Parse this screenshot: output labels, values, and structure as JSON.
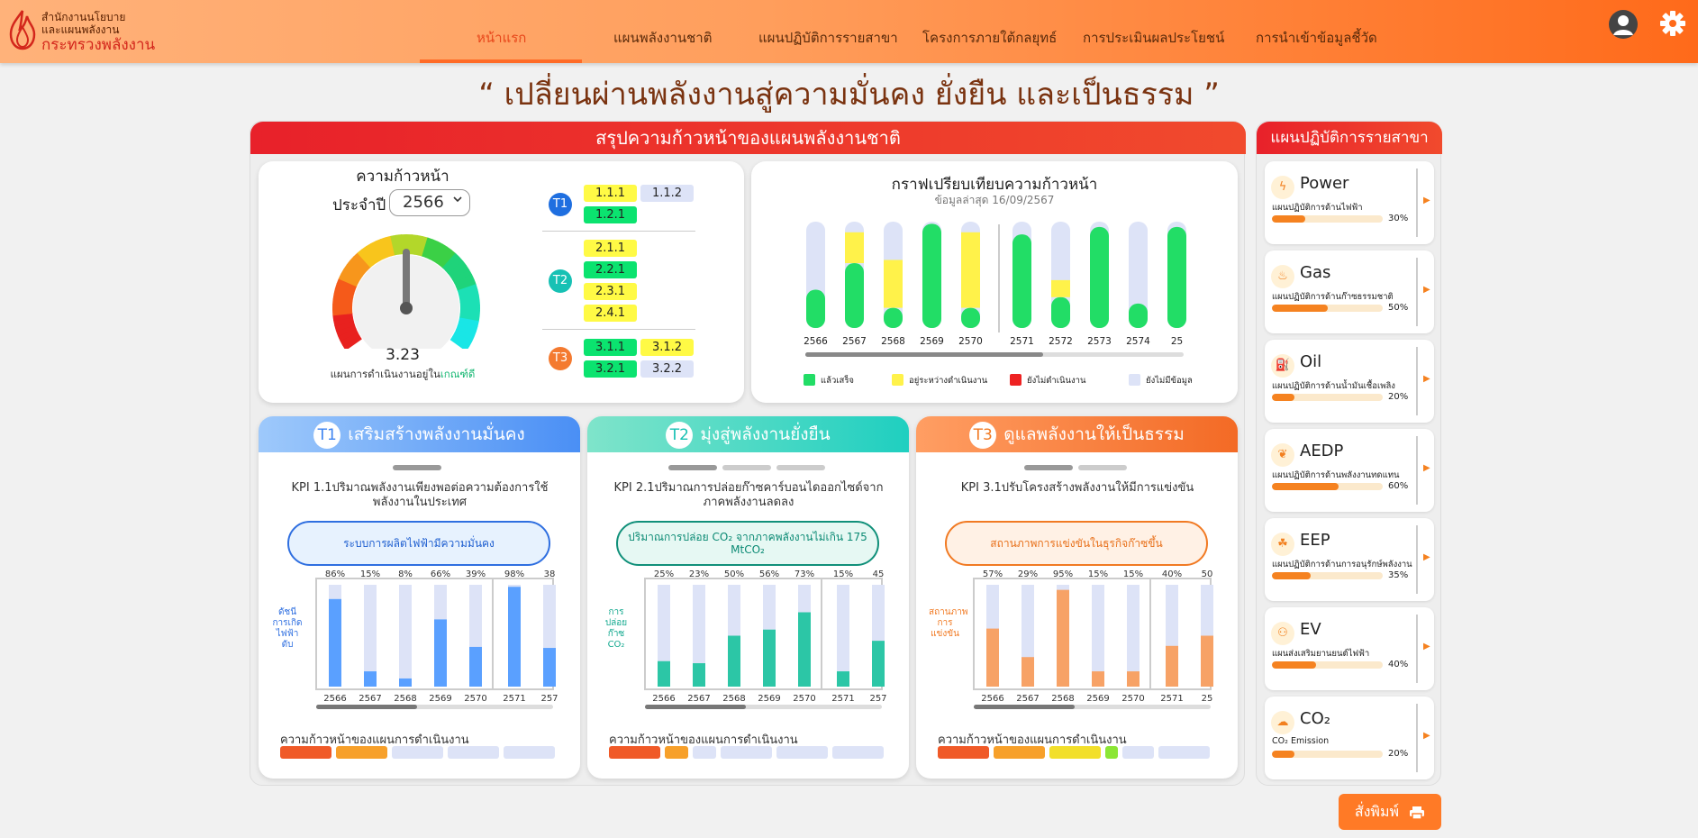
{
  "logo": {
    "line1": "สำนักงานนโยบาย",
    "line2": "และแผนพลังงาน",
    "line3": "กระทรวงพลังงาน"
  },
  "nav": {
    "items": [
      "หน้าแรก",
      "แผนพลังงานชาติ",
      "แผนปฏิบัติการรายสาขา",
      "โครงการภายใต้กลยุทธ์",
      "การประเมินผลประโยชน์",
      "การนำเข้าข้อมูลชี้วัด"
    ],
    "active": 0
  },
  "quote": "“ เปลี่ยนผ่านพลังงานสู่ความมั่นคง ยั่งยืน และเป็นธรรม ”",
  "main_panel": {
    "title": "สรุปความก้าวหน้าของแผนพลังงานชาติ"
  },
  "progress_card": {
    "title": "ความก้าวหน้า",
    "year_label": "ประจำปี",
    "year_value": "2566",
    "gauge_value": "3.23",
    "gauge_fraction": 0.5,
    "status_prefix": "แผนการดำเนินงานอยู่ใน",
    "status_word": "เกณฑ์ดี",
    "groups": [
      {
        "badge": "T1",
        "color": "#1f6fe0",
        "chips": [
          {
            "label": "1.1.1",
            "status": "y"
          },
          {
            "label": "1.1.2",
            "status": "gr"
          },
          {
            "label": "1.2.1",
            "status": "g"
          }
        ]
      },
      {
        "badge": "T2",
        "color": "#17c1b4",
        "chips": [
          {
            "label": "2.1.1",
            "status": "y"
          },
          {
            "label": "2.2.1",
            "status": "g"
          },
          {
            "label": "2.3.1",
            "status": "y"
          },
          {
            "label": "2.4.1",
            "status": "y"
          }
        ]
      },
      {
        "badge": "T3",
        "color": "#f47a30",
        "chips": [
          {
            "label": "3.1.1",
            "status": "g"
          },
          {
            "label": "3.1.2",
            "status": "y"
          },
          {
            "label": "3.2.1",
            "status": "g"
          },
          {
            "label": "3.2.2",
            "status": "gr"
          }
        ]
      }
    ]
  },
  "compare_card": {
    "title": "กราฟเปรียบเทียบความก้าวหน้า",
    "subtitle": "ข้อมูลล่าสุด 16/09/2567",
    "legend": [
      {
        "label": "แล้วเสร็จ",
        "color": "#22dd66"
      },
      {
        "label": "อยู่ระหว่างดำเนินงาน",
        "color": "#fff24a"
      },
      {
        "label": "ยังไม่ดำเนินงาน",
        "color": "#ee2222"
      },
      {
        "label": "ยังไม่มีข้อมูล",
        "color": "#dde3f7"
      }
    ]
  },
  "themes": [
    {
      "badge": "T1",
      "title": "เสริมสร้างพลังงานมั่นคง",
      "kpi": "KPI 1.1ปริมาณพลังงานเพียงพอต่อความต้องการใช้พลังงานในประเทศ",
      "pill": "ระบบการผลิตไฟฟ้ามีความมั่นคง",
      "ylabel": "ดัชนีการเกิดไฟฟ้าดับ",
      "progress_label": "ความก้าวหน้าของแผนการดำเนินงาน",
      "color": "#5aa0ff",
      "light": "#e7f2fe",
      "accent": "#2f6fe0"
    },
    {
      "badge": "T2",
      "title": "มุ่งสู่พลังงานยั่งยืน",
      "kpi": "KPI 2.1ปริมาณการปล่อยก๊าซคาร์บอนไดออกไซด์จากภาคพลังงานลดลง",
      "pill": "ปริมาณการปล่อย CO₂ จากภาคพลังงานไม่เกิน 175 MtCO₂",
      "ylabel": "การปล่อยก๊าซ CO₂",
      "progress_label": "ความก้าวหน้าของแผนการดำเนินงาน",
      "color": "#2cc6a6",
      "light": "#e6f8f3",
      "accent": "#11907a"
    },
    {
      "badge": "T3",
      "title": "ดูแลพลังงานให้เป็นธรรม",
      "kpi": "KPI 3.1ปรับโครงสร้างพลังงานให้มีการแข่งขัน",
      "pill": "สถานภาพการแข่งขันในธุรกิจก๊าซขึ้น",
      "ylabel": "สถานภาพการแข่งขัน",
      "progress_label": "ความก้าวหน้าของแผนการดำเนินงาน",
      "color": "#f7a266",
      "light": "#fff1e5",
      "accent": "#f17a23"
    }
  ],
  "sector_panel": {
    "title": "แผนปฏิบัติการรายสาขา",
    "items": [
      {
        "name": "Power",
        "desc": "แผนปฏิบัติการด้านไฟฟ้า",
        "pct": "30%",
        "value": 0.3,
        "icon": "ϟ"
      },
      {
        "name": "Gas",
        "desc": "แผนปฏิบัติการด้านก๊าซธรรมชาติ",
        "pct": "50%",
        "value": 0.5,
        "icon": "♨"
      },
      {
        "name": "Oil",
        "desc": "แผนปฏิบัติการด้านน้ำมันเชื้อเพลิง",
        "pct": "20%",
        "value": 0.2,
        "icon": "⛽"
      },
      {
        "name": "AEDP",
        "desc": "แผนปฏิบัติการด้านพลังงานทดแทน",
        "pct": "60%",
        "value": 0.6,
        "icon": "❦"
      },
      {
        "name": "EEP",
        "desc": "แผนปฏิบัติการด้านการอนุรักษ์พลังงาน",
        "pct": "35%",
        "value": 0.35,
        "icon": "☘"
      },
      {
        "name": "EV",
        "desc": "แผนส่งเสริมยานยนต์ไฟฟ้า",
        "pct": "40%",
        "value": 0.4,
        "icon": "⚇"
      },
      {
        "name": "CO₂",
        "desc": "CO₂ Emission",
        "pct": "20%",
        "value": 0.2,
        "icon": "☁"
      }
    ]
  },
  "print_label": "สั่งพิมพ์",
  "chart_data": [
    {
      "type": "bar",
      "title": "กราฟเปรียบเทียบความก้าวหน้า",
      "categories": [
        "2566",
        "2567",
        "2568",
        "2569",
        "2570",
        "2571",
        "2572",
        "2573",
        "2574",
        "25"
      ],
      "series": [
        {
          "name": "แล้วเสร็จ",
          "values": [
            0.36,
            0.61,
            0.19,
            0.98,
            0.19,
            0.88,
            0.29,
            0.95,
            0.23,
            0.95
          ]
        },
        {
          "name": "อยู่ระหว่างดำเนินงาน",
          "values": [
            0,
            0.29,
            0.45,
            0,
            0.71,
            0,
            0.16,
            0,
            0,
            0
          ]
        },
        {
          "name": "ยังไม่มีข้อมูล",
          "values": [
            0.64,
            0.1,
            0.36,
            0.02,
            0.1,
            0.12,
            0.55,
            0.05,
            0.77,
            0.05
          ]
        }
      ],
      "ylim": [
        0,
        1
      ]
    },
    {
      "type": "bar",
      "categories": [
        "2566",
        "2567",
        "2568",
        "2569",
        "2570",
        "2571",
        "257"
      ],
      "values": [
        86,
        15,
        8,
        66,
        39,
        98,
        38
      ],
      "labels": [
        "86%",
        "15%",
        "8%",
        "66%",
        "39%",
        "98%",
        "38"
      ],
      "ylim": [
        0,
        100
      ],
      "ylabel": "ดัชนีการเกิดไฟฟ้าดับ"
    },
    {
      "type": "bar",
      "categories": [
        "2566",
        "2567",
        "2568",
        "2569",
        "2570",
        "2571",
        "257"
      ],
      "values": [
        25,
        23,
        50,
        56,
        73,
        15,
        45
      ],
      "labels": [
        "25%",
        "23%",
        "50%",
        "56%",
        "73%",
        "15%",
        "45"
      ],
      "ylim": [
        0,
        100
      ],
      "ylabel": "การปล่อยก๊าซ CO₂"
    },
    {
      "type": "bar",
      "categories": [
        "2566",
        "2567",
        "2568",
        "2569",
        "2570",
        "2571",
        "25"
      ],
      "values": [
        57,
        29,
        95,
        15,
        15,
        40,
        50
      ],
      "labels": [
        "57%",
        "29%",
        "95%",
        "15%",
        "15%",
        "40%",
        "50"
      ],
      "ylim": [
        0,
        100
      ],
      "ylabel": "สถานภาพการแข่งขัน"
    }
  ],
  "theme_progress": [
    [
      {
        "color": "#f05a28",
        "w": 0.19
      },
      {
        "color": "#f7a02a",
        "w": 0.19
      },
      {
        "color": "#dde3f7",
        "w": 0.19
      },
      {
        "color": "#dde3f7",
        "w": 0.19
      },
      {
        "color": "#dde3f7",
        "w": 0.19
      }
    ],
    [
      {
        "color": "#f05a28",
        "w": 0.19
      },
      {
        "color": "#f7a02a",
        "w": 0.09
      },
      {
        "color": "#dde3f7",
        "w": 0.09
      },
      {
        "color": "#dde3f7",
        "w": 0.19
      },
      {
        "color": "#dde3f7",
        "w": 0.19
      },
      {
        "color": "#dde3f7",
        "w": 0.19
      }
    ],
    [
      {
        "color": "#f05a28",
        "w": 0.19
      },
      {
        "color": "#f7a02a",
        "w": 0.19
      },
      {
        "color": "#f2df2a",
        "w": 0.19
      },
      {
        "color": "#8be635",
        "w": 0.05
      },
      {
        "color": "#dde3f7",
        "w": 0.12
      },
      {
        "color": "#dde3f7",
        "w": 0.19
      }
    ]
  ]
}
